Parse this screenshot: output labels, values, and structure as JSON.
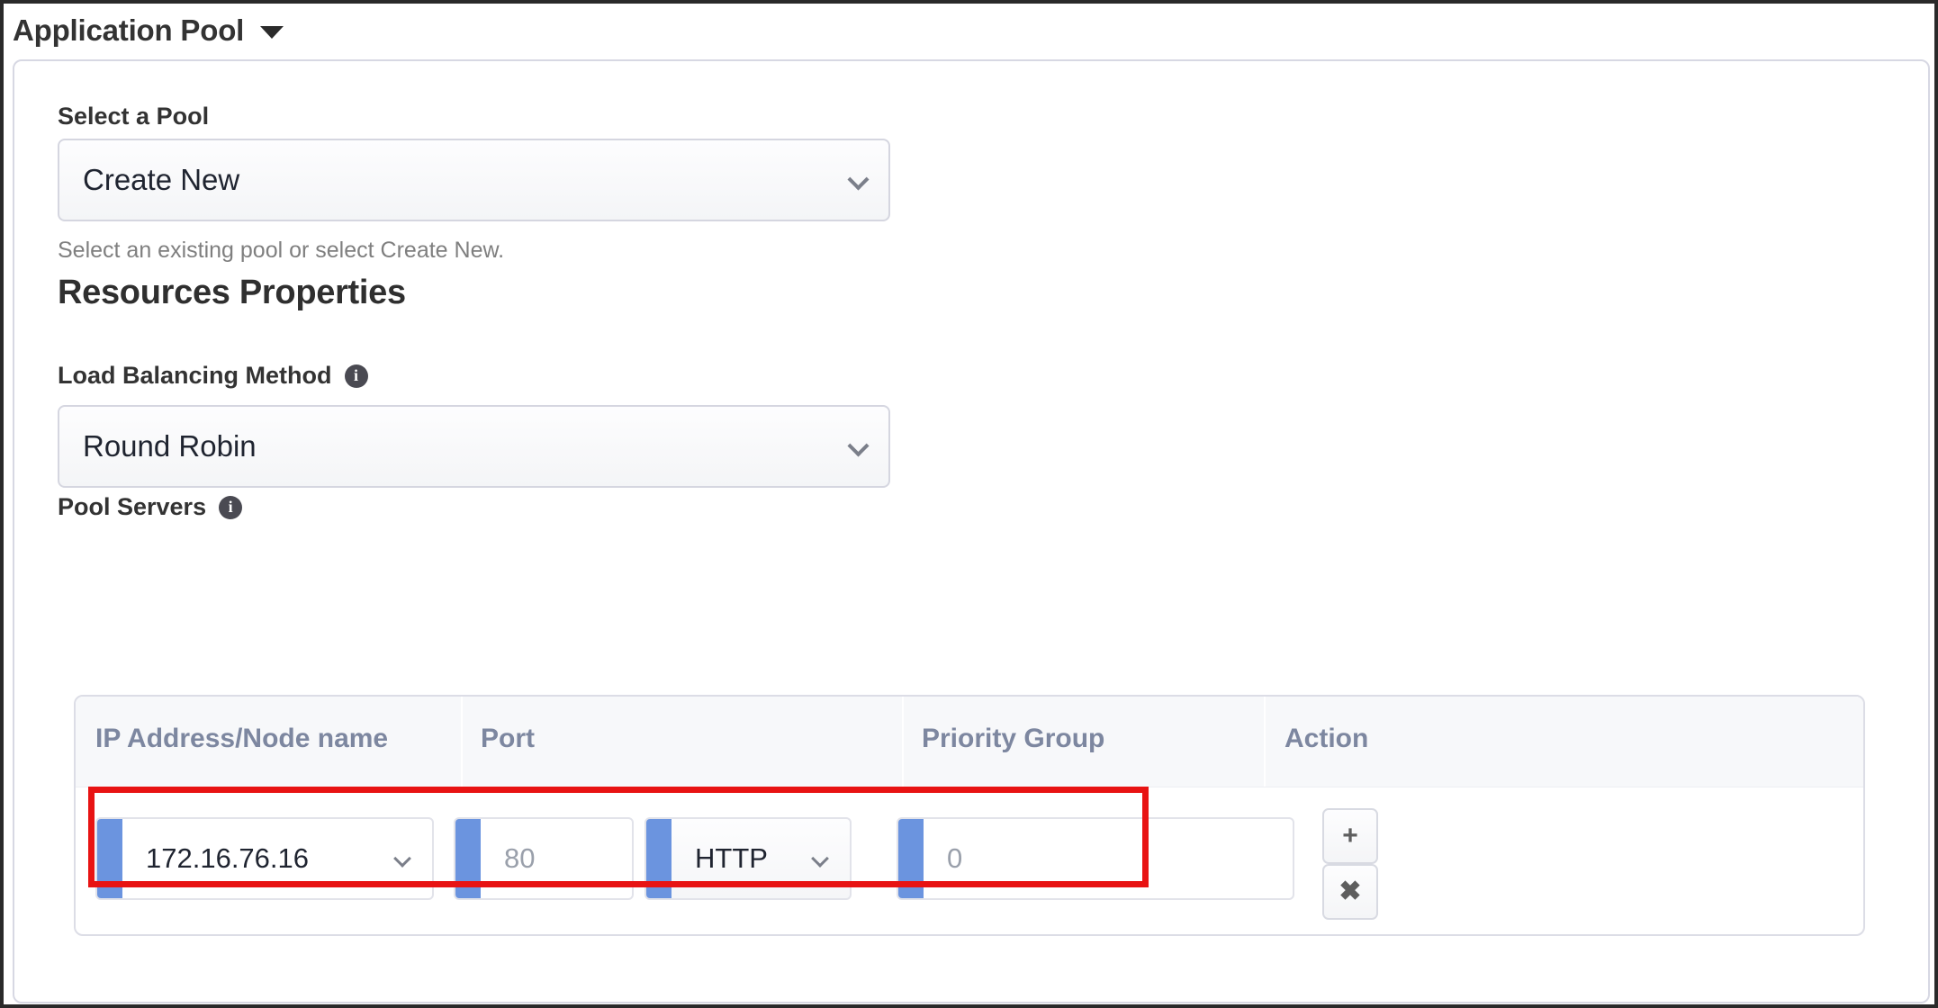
{
  "header": {
    "title": "Application Pool",
    "caret_icon": "caret-down-icon"
  },
  "form": {
    "select_pool": {
      "label": "Select a Pool",
      "value": "Create New",
      "helper": "Select an existing pool or select Create New."
    },
    "resources_heading": "Resources Properties",
    "load_balancing": {
      "label": "Load Balancing Method",
      "info_icon": "info-icon",
      "value": "Round Robin"
    },
    "pool_servers": {
      "label": "Pool Servers",
      "info_icon": "info-icon"
    }
  },
  "table": {
    "columns": [
      {
        "label": "IP Address/Node name"
      },
      {
        "label": "Port"
      },
      {
        "label": "Priority Group"
      },
      {
        "label": "Action"
      }
    ],
    "rows": [
      {
        "ip_address": "172.16.76.16",
        "port": "80",
        "protocol": "HTTP",
        "priority_group": "0",
        "add_label": "+",
        "remove_label": "✖"
      }
    ]
  },
  "colors": {
    "accent_blue": "#6b94df",
    "highlight_red": "#e81313",
    "header_text": "#7d87a0",
    "panel_border": "#d7d8e3"
  }
}
